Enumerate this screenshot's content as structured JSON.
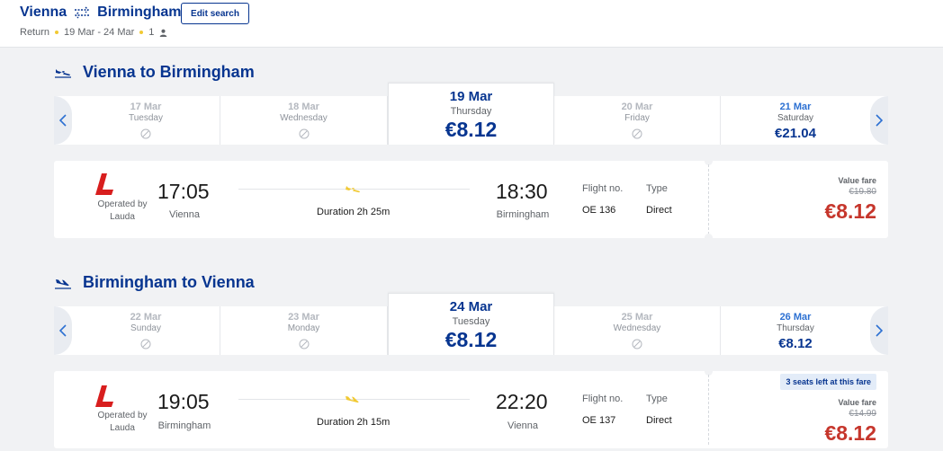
{
  "header": {
    "origin": "Vienna",
    "destination": "Birmingham",
    "edit_search_label": "Edit search",
    "trip_type": "Return",
    "dates": "19 Mar - 24 Mar",
    "passengers": "1"
  },
  "outbound": {
    "title": "Vienna to Birmingham",
    "dates": [
      {
        "date": "17 Mar",
        "weekday": "Tuesday",
        "price": null,
        "available": false
      },
      {
        "date": "18 Mar",
        "weekday": "Wednesday",
        "price": null,
        "available": false
      },
      {
        "date": "19 Mar",
        "weekday": "Thursday",
        "price": "€8.12",
        "available": true,
        "selected": true
      },
      {
        "date": "20 Mar",
        "weekday": "Friday",
        "price": null,
        "available": false
      },
      {
        "date": "21 Mar",
        "weekday": "Saturday",
        "price": "€21.04",
        "available": true
      }
    ],
    "flight": {
      "operated_by": "Operated by",
      "operator": "Lauda",
      "depart_time": "17:05",
      "depart_city": "Vienna",
      "duration": "Duration 2h 25m",
      "arrive_time": "18:30",
      "arrive_city": "Birmingham",
      "flight_no_label": "Flight no.",
      "flight_no": "OE 136",
      "type_label": "Type",
      "type": "Direct",
      "fare_label": "Value fare",
      "old_price": "€19.80",
      "price": "€8.12"
    }
  },
  "inbound": {
    "title": "Birmingham to Vienna",
    "dates": [
      {
        "date": "22 Mar",
        "weekday": "Sunday",
        "price": null,
        "available": false
      },
      {
        "date": "23 Mar",
        "weekday": "Monday",
        "price": null,
        "available": false
      },
      {
        "date": "24 Mar",
        "weekday": "Tuesday",
        "price": "€8.12",
        "available": true,
        "selected": true
      },
      {
        "date": "25 Mar",
        "weekday": "Wednesday",
        "price": null,
        "available": false
      },
      {
        "date": "26 Mar",
        "weekday": "Thursday",
        "price": "€8.12",
        "available": true
      }
    ],
    "flight": {
      "operated_by": "Operated by",
      "operator": "Lauda",
      "depart_time": "19:05",
      "depart_city": "Birmingham",
      "duration": "Duration 2h 15m",
      "arrive_time": "22:20",
      "arrive_city": "Vienna",
      "flight_no_label": "Flight no.",
      "flight_no": "OE 137",
      "type_label": "Type",
      "type": "Direct",
      "seats_left": "3 seats left at this fare",
      "fare_label": "Value fare",
      "old_price": "€14.99",
      "price": "€8.12"
    }
  },
  "colors": {
    "brand_blue": "#073590",
    "link_blue": "#2c70d2",
    "price_red": "#c6362c",
    "accent_yellow": "#f1c933",
    "lauda_red": "#d81e1e"
  },
  "icons": {
    "swap": "return-arrows-icon",
    "person": "person-icon",
    "outbound_plane": "plane-takeoff-icon",
    "inbound_plane": "plane-landing-icon",
    "unavailable": "no-flight-icon",
    "logo": "lauda-logo-icon"
  }
}
